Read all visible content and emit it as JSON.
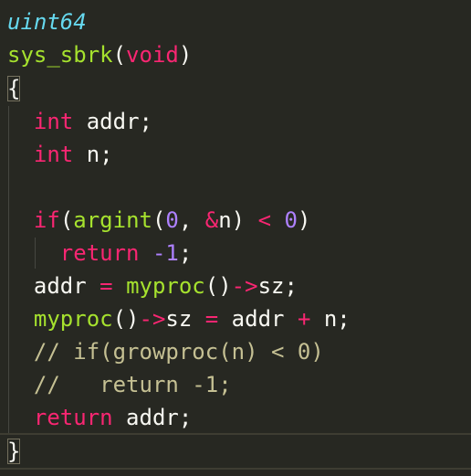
{
  "editor": {
    "lines": [
      {
        "tokens": [
          {
            "t": "uint64",
            "c": "ty-italic"
          }
        ]
      },
      {
        "tokens": [
          {
            "t": "sys_sbrk",
            "c": "fn"
          },
          {
            "t": "(",
            "c": "plain"
          },
          {
            "t": "void",
            "c": "kw"
          },
          {
            "t": ")",
            "c": "plain"
          }
        ]
      },
      {
        "tokens": [
          {
            "t": "{",
            "c": "plain"
          }
        ]
      },
      {
        "tokens": [
          {
            "t": "  ",
            "c": "plain"
          },
          {
            "t": "int",
            "c": "kw"
          },
          {
            "t": " addr;",
            "c": "plain"
          }
        ]
      },
      {
        "tokens": [
          {
            "t": "  ",
            "c": "plain"
          },
          {
            "t": "int",
            "c": "kw"
          },
          {
            "t": " n;",
            "c": "plain"
          }
        ]
      },
      {
        "tokens": []
      },
      {
        "tokens": [
          {
            "t": "  ",
            "c": "plain"
          },
          {
            "t": "if",
            "c": "kw"
          },
          {
            "t": "(",
            "c": "plain"
          },
          {
            "t": "argint",
            "c": "fn"
          },
          {
            "t": "(",
            "c": "plain"
          },
          {
            "t": "0",
            "c": "num"
          },
          {
            "t": ", ",
            "c": "plain"
          },
          {
            "t": "&",
            "c": "op"
          },
          {
            "t": "n) ",
            "c": "plain"
          },
          {
            "t": "<",
            "c": "op"
          },
          {
            "t": " ",
            "c": "plain"
          },
          {
            "t": "0",
            "c": "num"
          },
          {
            "t": ")",
            "c": "plain"
          }
        ]
      },
      {
        "tokens": [
          {
            "t": "    ",
            "c": "plain"
          },
          {
            "t": "return",
            "c": "kw"
          },
          {
            "t": " ",
            "c": "plain"
          },
          {
            "t": "-1",
            "c": "num"
          },
          {
            "t": ";",
            "c": "plain"
          }
        ]
      },
      {
        "tokens": [
          {
            "t": "  addr ",
            "c": "plain"
          },
          {
            "t": "=",
            "c": "op"
          },
          {
            "t": " ",
            "c": "plain"
          },
          {
            "t": "myproc",
            "c": "fn"
          },
          {
            "t": "()",
            "c": "plain"
          },
          {
            "t": "->",
            "c": "op"
          },
          {
            "t": "sz;",
            "c": "plain"
          }
        ]
      },
      {
        "tokens": [
          {
            "t": "  ",
            "c": "plain"
          },
          {
            "t": "myproc",
            "c": "fn"
          },
          {
            "t": "()",
            "c": "plain"
          },
          {
            "t": "->",
            "c": "op"
          },
          {
            "t": "sz ",
            "c": "plain"
          },
          {
            "t": "=",
            "c": "op"
          },
          {
            "t": " addr ",
            "c": "plain"
          },
          {
            "t": "+",
            "c": "op"
          },
          {
            "t": " n;",
            "c": "plain"
          }
        ]
      },
      {
        "tokens": [
          {
            "t": "  // if(growproc(n) < 0)",
            "c": "comment"
          }
        ]
      },
      {
        "tokens": [
          {
            "t": "  //   return -1;",
            "c": "comment"
          }
        ]
      },
      {
        "tokens": [
          {
            "t": "  ",
            "c": "plain"
          },
          {
            "t": "return",
            "c": "kw"
          },
          {
            "t": " addr;",
            "c": "plain"
          }
        ]
      },
      {
        "tokens": [
          {
            "t": "}",
            "c": "plain"
          }
        ]
      }
    ]
  },
  "colors": {
    "background": "#272822",
    "keyword": "#f92672",
    "function": "#a6e22e",
    "type": "#66d9ef",
    "number": "#ae81ff",
    "comment": "#c5c093",
    "text": "#f8f8f2"
  }
}
